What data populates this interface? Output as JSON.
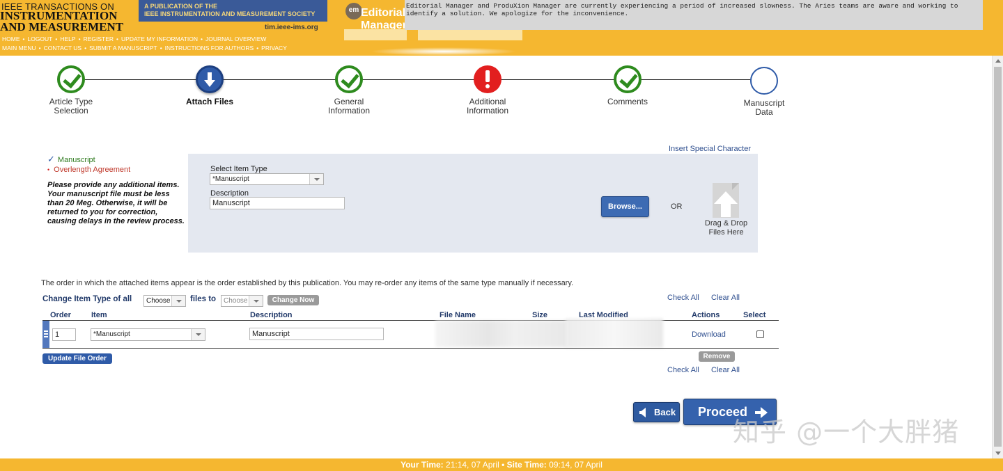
{
  "header": {
    "journal_line1": "IEEE TRANSACTIONS ON",
    "journal_line2": "INSTRUMENTATION",
    "journal_line3": "AND MEASUREMENT",
    "publication_line1": "A PUBLICATION OF THE",
    "publication_line2": "IEEE INSTRUMENTATION AND MEASUREMENT SOCIETY",
    "site": "tim.ieee-ims.org",
    "em_badge": "em",
    "em_title": "Editorial Manager",
    "notice": "Editorial Manager and ProduXion Manager are currently experiencing a period of increased slowness. The Aries teams are aware and working to identify a solution. We apologize for the inconvenience.",
    "nav_row1": [
      "HOME",
      "LOGOUT",
      "HELP",
      "REGISTER",
      "UPDATE MY INFORMATION",
      "JOURNAL OVERVIEW"
    ],
    "nav_row2": [
      "MAIN MENU",
      "CONTACT US",
      "SUBMIT A MANUSCRIPT",
      "INSTRUCTIONS FOR AUTHORS",
      "PRIVACY"
    ]
  },
  "stepper": {
    "steps": [
      {
        "label_a": "Article Type",
        "label_b": "Selection",
        "status": "complete"
      },
      {
        "label_a": "Attach Files",
        "label_b": "",
        "status": "current"
      },
      {
        "label_a": "General",
        "label_b": "Information",
        "status": "complete"
      },
      {
        "label_a": "Additional",
        "label_b": "Information",
        "status": "error"
      },
      {
        "label_a": "Comments",
        "label_b": "",
        "status": "complete"
      },
      {
        "label_a": "Manuscript",
        "label_b": "Data",
        "status": "incomplete"
      }
    ]
  },
  "requirements": {
    "done_mark": "✓",
    "done_label": "Manuscript",
    "missing_mark": "•",
    "missing_label": "Overlength Agreement",
    "instruction": "Please provide any additional items. Your manuscript file must be less than 20 Meg. Otherwise, it will be returned to you for correction, causing delays in the review process."
  },
  "upload": {
    "insert_special": "Insert Special Character",
    "select_item_type_label": "Select Item Type",
    "item_type_value": "*Manuscript",
    "description_label": "Description",
    "description_value": "Manuscript",
    "browse_label": "Browse...",
    "or_label": "OR",
    "drag_drop_line1": "Drag & Drop",
    "drag_drop_line2": "Files Here"
  },
  "order": {
    "note": "The order in which the attached items appear is the order established by this publication. You may re-order any items of the same type manually if necessary.",
    "change_prefix": "Change Item Type of all",
    "change_mid": "files to",
    "choose_from": "Choose",
    "choose_to": "Choose",
    "change_now": "Change Now",
    "check_all": "Check All",
    "clear_all": "Clear All",
    "columns": {
      "order": "Order",
      "item": "Item",
      "description": "Description",
      "file_name": "File Name",
      "size": "Size",
      "last_modified": "Last Modified",
      "actions": "Actions",
      "select": "Select"
    },
    "row": {
      "order": "1",
      "item": "*Manuscript",
      "description": "Manuscript",
      "action": "Download"
    },
    "update_order": "Update File Order",
    "remove": "Remove"
  },
  "nav_buttons": {
    "back": "Back",
    "proceed": "Proceed"
  },
  "watermark": "知乎 @一个大胖猪",
  "footer": {
    "your_time_label": "Your Time:",
    "your_time_value": "21:14, 07 April",
    "separator": "•",
    "site_time_label": "Site Time:",
    "site_time_value": "09:14, 07 April"
  },
  "colors": {
    "header_bg": "#f5b730",
    "primary_blue": "#2f5ba8",
    "complete_green": "#2e8b1e",
    "error_red": "#e21f1f",
    "panel_bg": "#e4e8f0"
  }
}
